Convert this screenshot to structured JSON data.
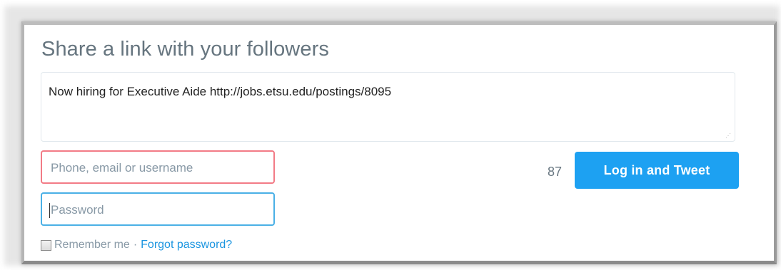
{
  "title": "Share a link with your followers",
  "tweet": {
    "text": "Now hiring for Executive Aide http://jobs.etsu.edu/postings/8095"
  },
  "login": {
    "username_placeholder": "Phone, email or username",
    "password_placeholder": "Password",
    "remember_label": "Remember me",
    "separator": "·",
    "forgot_label": "Forgot password?"
  },
  "counter": "87",
  "submit_label": "Log in and Tweet",
  "colors": {
    "accent": "#1da1f2",
    "error_border": "#f27b86",
    "focus_border": "#4ab0e6",
    "link": "#1b95e0"
  }
}
